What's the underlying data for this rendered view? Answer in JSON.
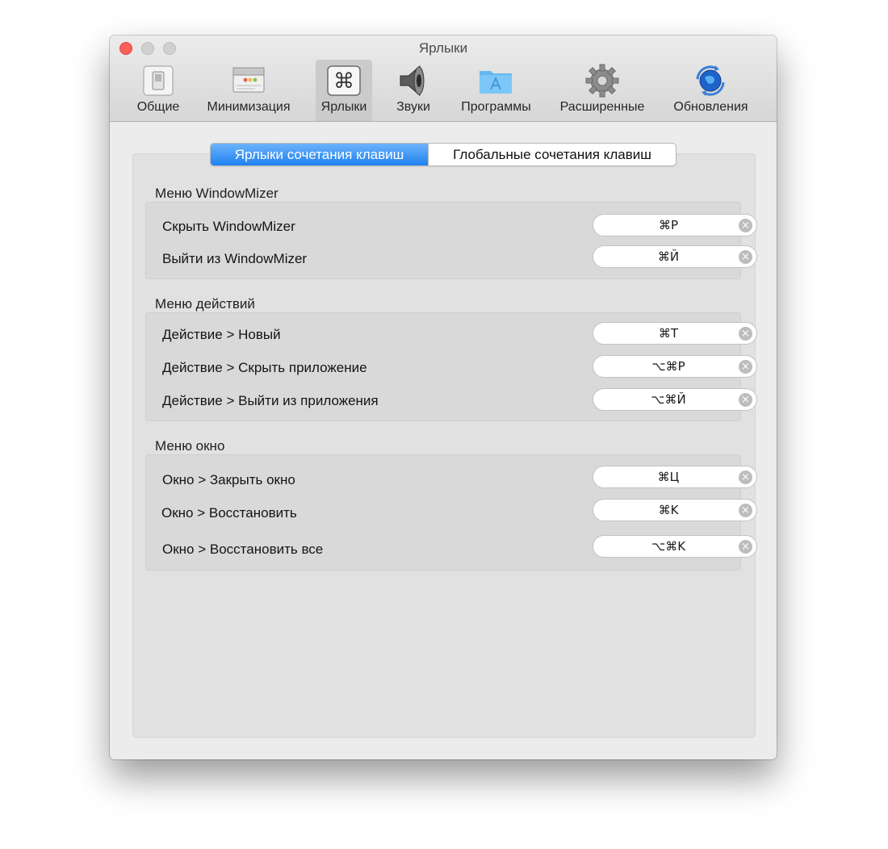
{
  "window": {
    "title": "Ярлыки"
  },
  "toolbar": {
    "items": [
      {
        "label": "Общие",
        "icon": "switch-icon"
      },
      {
        "label": "Минимизация",
        "icon": "window-icon"
      },
      {
        "label": "Ярлыки",
        "icon": "command-key-icon",
        "selected": true
      },
      {
        "label": "Звуки",
        "icon": "speaker-icon"
      },
      {
        "label": "Программы",
        "icon": "applications-folder-icon"
      },
      {
        "label": "Расширенные",
        "icon": "gear-icon"
      },
      {
        "label": "Обновления",
        "icon": "update-globe-icon"
      }
    ]
  },
  "tabs": {
    "active": "Ярлыки сочетания клавиш",
    "inactive": "Глобальные сочетания клавиш"
  },
  "sections": [
    {
      "title": "Меню WindowMizer",
      "rows": [
        {
          "label": "Скрыть WindowMizer",
          "shortcut": "⌘P"
        },
        {
          "label": "Выйти из WindowMizer",
          "shortcut": "⌘Й"
        }
      ]
    },
    {
      "title": "Меню действий",
      "rows": [
        {
          "label": "Действие > Новый",
          "shortcut": "⌘T"
        },
        {
          "label": "Действие > Скрыть приложение",
          "shortcut": "⌥⌘P"
        },
        {
          "label": "Действие > Выйти из приложения",
          "shortcut": "⌥⌘Й"
        }
      ]
    },
    {
      "title": "Меню окно",
      "rows": [
        {
          "label": "Окно > Закрыть окно",
          "shortcut": "⌘Ц"
        },
        {
          "label": "Окно > Восстановить",
          "shortcut": "⌘K"
        },
        {
          "label": "Окно > Восстановить все",
          "shortcut": "⌥⌘K"
        }
      ]
    }
  ],
  "clear_glyph": "×",
  "colors": {
    "accent": "#2584f0",
    "close": "#fc5f57"
  }
}
